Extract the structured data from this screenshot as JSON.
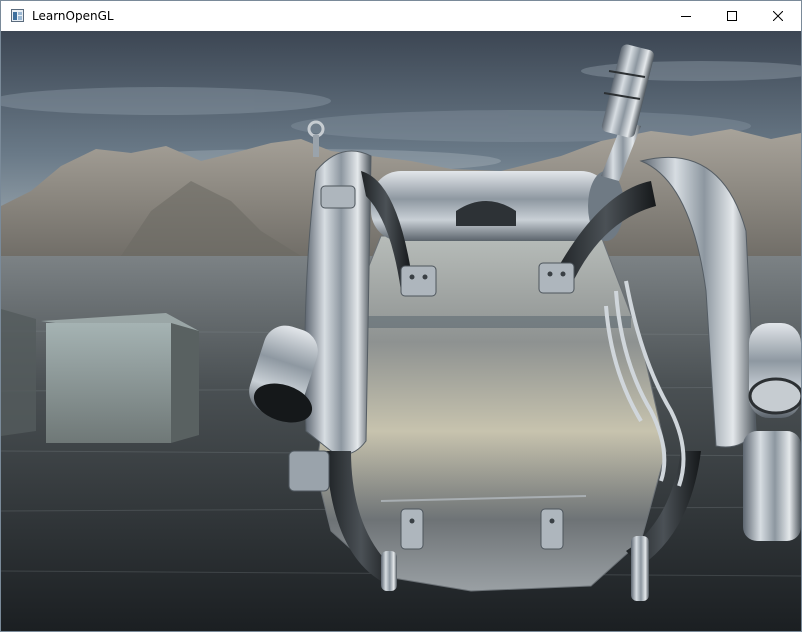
{
  "window": {
    "title": "LearnOpenGL",
    "icons": {
      "app": "opengl-window-icon",
      "minimize": "minimize-icon",
      "maximize": "maximize-icon",
      "close": "close-icon"
    }
  },
  "scene": {
    "description_colors": {
      "sky_top": "#3c4653",
      "sky_bottom": "#8fa1ad",
      "mountains": "#9c9890",
      "water_top": "#6b7174",
      "water_bottom": "#1d2124",
      "chrome": "#c9d0d6"
    }
  }
}
